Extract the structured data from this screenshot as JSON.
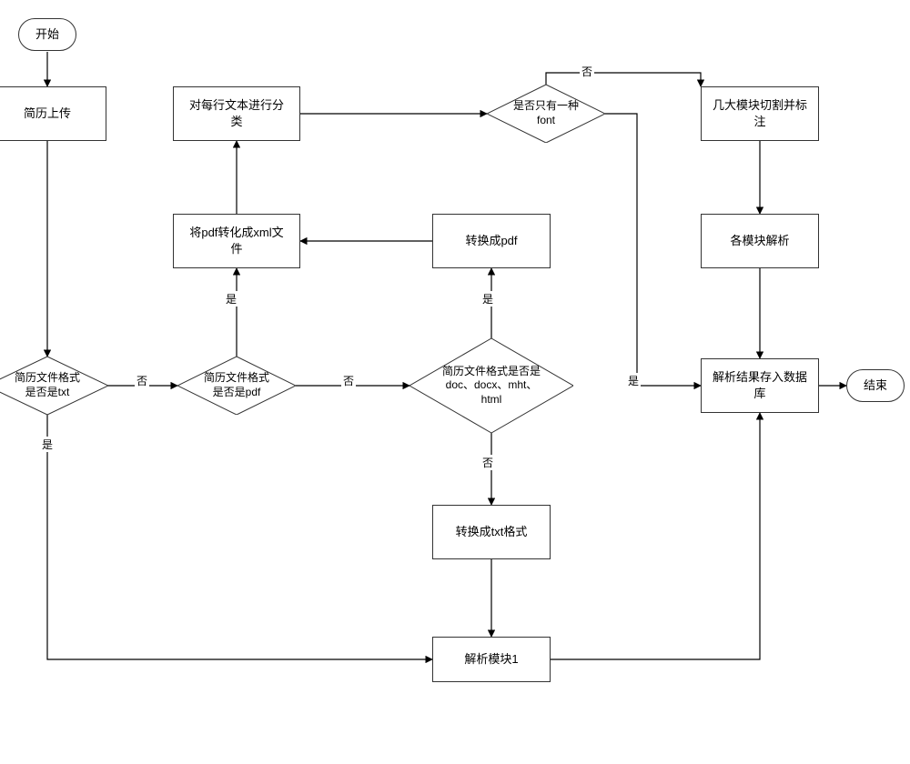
{
  "terminators": {
    "start": "开始",
    "end": "结束"
  },
  "processes": {
    "upload": "简历上传",
    "classify_lines": "对每行文本进行分\n类",
    "pdf_to_xml": "将pdf转化成xml文\n件",
    "to_pdf": "转换成pdf",
    "cut_label": "几大模块切割并标\n注",
    "parse_modules": "各模块解析",
    "save_db": "解析结果存入数据\n库",
    "to_txt": "转换成txt格式",
    "parse_mod1": "解析模块1"
  },
  "decisions": {
    "is_txt": "简历文件格式\n是否是txt",
    "is_pdf": "简历文件格式\n是否是pdf",
    "is_doc": "简历文件格式是否是\ndoc、docx、mht、\nhtml",
    "one_font": "是否只有一种\nfont"
  },
  "labels": {
    "yes": "是",
    "no": "否"
  }
}
